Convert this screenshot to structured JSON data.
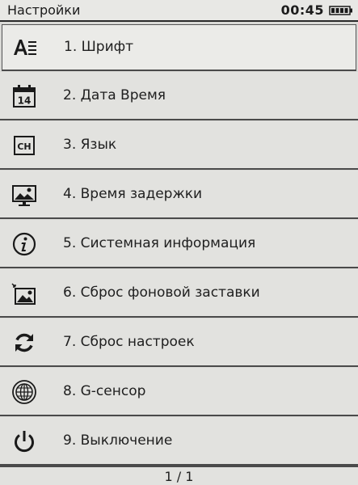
{
  "status_bar": {
    "title": "Настройки",
    "time": "00:45",
    "battery_icon": "battery-full-icon"
  },
  "menu": {
    "items": [
      {
        "label": "1. Шрифт",
        "icon": "font-icon",
        "selected": true
      },
      {
        "label": "2. Дата Время",
        "icon": "calendar-icon",
        "calendar_day": "14"
      },
      {
        "label": "3. Язык",
        "icon": "language-icon",
        "badge": "CH"
      },
      {
        "label": "4. Время задержки",
        "icon": "screen-delay-icon"
      },
      {
        "label": "5. Системная информация",
        "icon": "info-icon"
      },
      {
        "label": "6. Сброс фоновой заставки",
        "icon": "wallpaper-icon"
      },
      {
        "label": "7. Сброс настроек",
        "icon": "refresh-icon"
      },
      {
        "label": "8. G-сенсор",
        "icon": "globe-sensor-icon"
      },
      {
        "label": "9. Выключение",
        "icon": "power-icon"
      }
    ]
  },
  "footer": {
    "pager": "1 / 1"
  }
}
